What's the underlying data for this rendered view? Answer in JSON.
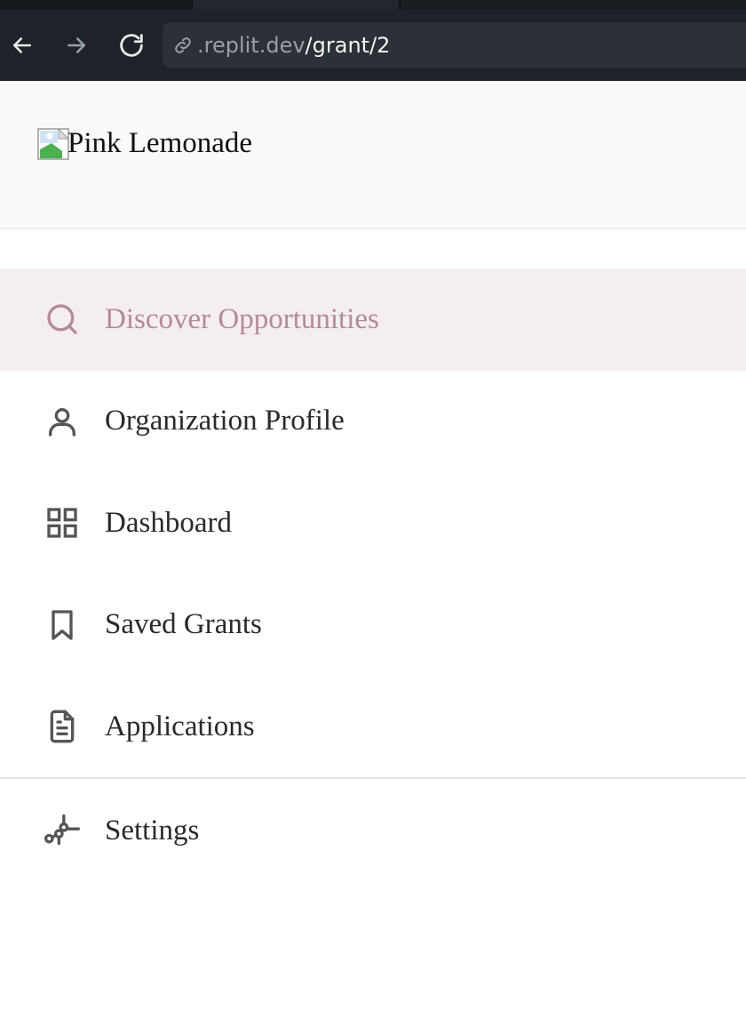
{
  "browser": {
    "url_host": ".replit.dev",
    "url_path": "/grant/2",
    "icons": {
      "back": "arrow-left-icon",
      "forward": "arrow-right-icon",
      "reload": "reload-icon",
      "link": "link-icon"
    }
  },
  "header": {
    "brand_alt": "Pink Lemonade",
    "brand_icon": "broken-image-icon"
  },
  "nav": {
    "items": [
      {
        "label": "Discover Opportunities",
        "icon": "search-icon",
        "active": true
      },
      {
        "label": "Organization Profile",
        "icon": "user-icon",
        "active": false
      },
      {
        "label": "Dashboard",
        "icon": "grid-icon",
        "active": false
      },
      {
        "label": "Saved Grants",
        "icon": "bookmark-icon",
        "active": false
      },
      {
        "label": "Applications",
        "icon": "document-icon",
        "active": false
      }
    ],
    "settings": {
      "label": "Settings",
      "icon": "settings-icon"
    }
  },
  "colors": {
    "browser_bg": "#1f2329",
    "address_bg": "#2c3037",
    "header_bg": "#fafafa",
    "active_bg": "#f4eef0",
    "active_text": "#b48a98",
    "text": "#2a2a2a",
    "icon": "#555555"
  }
}
